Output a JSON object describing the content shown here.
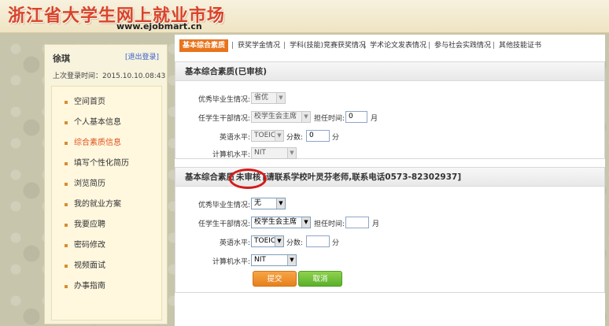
{
  "header": {
    "site_title": "浙江省大学生网上就业市场",
    "site_url": "www.ejobmart.cn"
  },
  "sidebar": {
    "user_name": "徐琪",
    "logout_label": "[退出登录]",
    "last_login": "上次登录时间：2015.10.10.08:43",
    "items": [
      {
        "label": "空间首页"
      },
      {
        "label": "个人基本信息"
      },
      {
        "label": "综合素质信息"
      },
      {
        "label": "填写个性化简历"
      },
      {
        "label": "浏览简历"
      },
      {
        "label": "我的就业方案"
      },
      {
        "label": "我要应聘"
      },
      {
        "label": "密码修改"
      },
      {
        "label": "视频面试"
      },
      {
        "label": "办事指南"
      }
    ],
    "active_index": 2
  },
  "tabs": [
    {
      "label": "基本综合素质"
    },
    {
      "label": "获奖学金情况"
    },
    {
      "label": "学科(技能)竞赛获奖情况"
    },
    {
      "label": "学术论文发表情况"
    },
    {
      "label": "参与社会实践情况"
    },
    {
      "label": "其他技能证书"
    }
  ],
  "approved": {
    "title": "基本综合素质(已审核)",
    "labels": {
      "graduate": "优秀毕业生情况:",
      "cadre": "任学生干部情况:",
      "english": "英语水平:",
      "computer": "计算机水平:"
    },
    "graduate_value": "省优",
    "cadre_value": "校学生会主席",
    "tenure_label": "担任时间:",
    "tenure_value": "0",
    "month_unit": "月",
    "english_value": "TOEIC",
    "score_label": "分数:",
    "score_value": "0",
    "score_unit": "分",
    "computer_value": "NIT"
  },
  "pending": {
    "title_prefix": "基本综合素质",
    "title_status": "未审核",
    "title_note": "[请联系学校叶灵芬老师,联系电话0573-82302937]",
    "labels": {
      "graduate": "优秀毕业生情况:",
      "cadre": "任学生干部情况:",
      "english": "英语水平:",
      "computer": "计算机水平:"
    },
    "graduate_value": "无",
    "cadre_value": "校学生会主席",
    "tenure_label": "担任时间:",
    "tenure_value": "",
    "month_unit": "月",
    "english_value": "TOEIC",
    "score_label": "分数:",
    "score_value": "",
    "score_unit": "分",
    "computer_value": "NIT",
    "submit_label": "提交",
    "cancel_label": "取消"
  },
  "icons": {
    "dropdown": "chevron-down-icon",
    "bullet": "square-bullet-icon"
  },
  "colors": {
    "accent_orange": "#e9741b",
    "title_red": "#d8442a",
    "annotation_red": "#d61a1a",
    "cancel_green": "#5ab02a"
  }
}
